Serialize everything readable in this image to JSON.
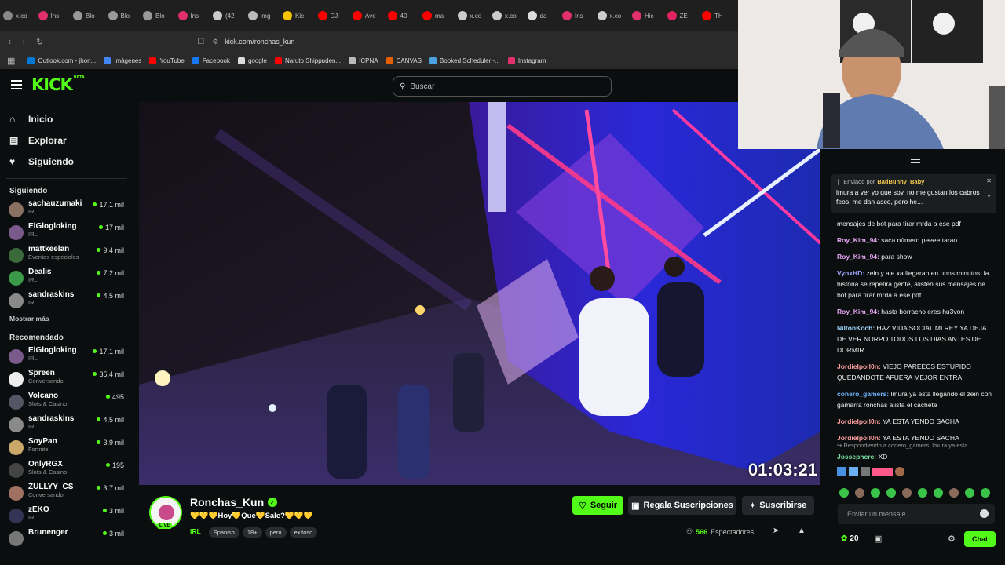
{
  "browser": {
    "tabs": [
      "x.co",
      "Ins",
      "Blo",
      "Blo",
      "Blo",
      "Ins",
      "(42",
      "img",
      "Kic",
      "DJ",
      "Ave",
      "40",
      "ma",
      "x.co",
      "x.co",
      "da",
      "Ins",
      "x.co",
      "Hic",
      "ZE",
      "TH"
    ],
    "tab_colors": [
      "#888",
      "#e1306c",
      "#999",
      "#999",
      "#999",
      "#e1306c",
      "#ccc",
      "#bbb",
      "#f5c400",
      "#ff0000",
      "#ff0000",
      "#ff0000",
      "#ff0000",
      "#ccc",
      "#ccc",
      "#ddd",
      "#e1306c",
      "#ccc",
      "#e1306c",
      "#e0245e",
      "#ff0000"
    ],
    "url": "kick.com/ronchas_kun",
    "bookmarks": [
      {
        "label": "Outlook.com - jhon...",
        "color": "#0078d4"
      },
      {
        "label": "Imágenes",
        "color": "#4285f4"
      },
      {
        "label": "YouTube",
        "color": "#ff0000"
      },
      {
        "label": "Facebook",
        "color": "#1877f2"
      },
      {
        "label": "google",
        "color": "#ddd"
      },
      {
        "label": "Naruto Shippuden...",
        "color": "#ff0000"
      },
      {
        "label": "ICPNA",
        "color": "#bbb"
      },
      {
        "label": "CANVAS",
        "color": "#e66000"
      },
      {
        "label": "Booked Scheduler -...",
        "color": "#4aa3df"
      },
      {
        "label": "Instagram",
        "color": "#e1306c"
      }
    ]
  },
  "kick": {
    "logo": "KICK",
    "logo_badge": "BETA",
    "search_placeholder": "Buscar",
    "brand_color": "#53fc18"
  },
  "sidebar": {
    "nav": [
      {
        "label": "Inicio",
        "icon": "home-icon"
      },
      {
        "label": "Explorar",
        "icon": "browse-icon"
      },
      {
        "label": "Siguiendo",
        "icon": "heart-icon"
      }
    ],
    "following_title": "Siguiendo",
    "following": [
      {
        "name": "sachauzumaki",
        "category": "IRL",
        "viewers": "17,1 mil",
        "color": "#8a7060"
      },
      {
        "name": "ElGlogloking",
        "category": "IRL",
        "viewers": "17 mil",
        "color": "#7a5a8a"
      },
      {
        "name": "mattkeelan",
        "category": "Eventos especiales",
        "viewers": "9,4 mil",
        "color": "#3a6a3a"
      },
      {
        "name": "Dealis",
        "category": "IRL",
        "viewers": "7,2 mil",
        "color": "#3a9a4a"
      },
      {
        "name": "sandraskins",
        "category": "IRL",
        "viewers": "4,5 mil",
        "color": "#8a8a8a"
      }
    ],
    "show_more": "Mostrar más",
    "recommended_title": "Recomendado",
    "recommended": [
      {
        "name": "ElGlogloking",
        "category": "IRL",
        "viewers": "17,1 mil",
        "color": "#7a5a8a"
      },
      {
        "name": "Spreen",
        "category": "Conversando",
        "viewers": "35,4 mil",
        "color": "#eee"
      },
      {
        "name": "Volcano",
        "category": "Slots & Casino",
        "viewers": "495",
        "color": "#556"
      },
      {
        "name": "sandraskins",
        "category": "IRL",
        "viewers": "4,5 mil",
        "color": "#8a8a8a"
      },
      {
        "name": "SoyPan",
        "category": "Fortnite",
        "viewers": "3,9 mil",
        "color": "#c9a86a"
      },
      {
        "name": "OnlyRGX",
        "category": "Slots & Casino",
        "viewers": "195",
        "color": "#444"
      },
      {
        "name": "ZULLYY_CS",
        "category": "Conversando",
        "viewers": "3,7 mil",
        "color": "#a07060"
      },
      {
        "name": "zEKO",
        "category": "IRL",
        "viewers": "3 mil",
        "color": "#335"
      },
      {
        "name": "Brunenger",
        "category": "",
        "viewers": "3 mil",
        "color": "#777"
      }
    ]
  },
  "video": {
    "timer": "01:03:21"
  },
  "stream": {
    "channel": "Ronchas_Kun",
    "live_badge": "LIVE",
    "title": "💛💛💛Hoy💛Que💛Sale?💛💛💛",
    "category": "IRL",
    "tags": [
      "Spanish",
      "18+",
      "perú",
      "exitoso"
    ],
    "follow_label": "Seguir",
    "gift_label": "Regala Suscripciones",
    "subscribe_label": "Suscribirse",
    "viewers_count": "566",
    "viewers_label": "Espectadores"
  },
  "chat": {
    "pinned_by_label": "Enviado por",
    "pinned_by_user": "BadBunny_Baby",
    "pinned_text": "lmura a ver yo que soy, no me gustan los cabros feos, me dan asco, pero he...",
    "messages": [
      {
        "user": "",
        "text": "mensajes de bot para tirar mrda a ese pdf",
        "color": "#ccc"
      },
      {
        "user": "Roy_Kim_94:",
        "text": "saca número peeee tarao",
        "color": "#e5a4f0"
      },
      {
        "user": "Roy_Kim_94:",
        "text": "para show",
        "color": "#e5a4f0"
      },
      {
        "user": "VynxHD:",
        "text": "zein y ale xa llegaran en unos minutos, la historia se repetira gente, alisten sus mensajes de bot para tirar mrda a ese pdf",
        "color": "#9fa8ff"
      },
      {
        "user": "Roy_Kim_94:",
        "text": "hasta borracho eres hu3von",
        "color": "#e5a4f0"
      },
      {
        "user": "NiltonKoch:",
        "text": "HAZ VIDA SOCIAL MI REY YA DEJA DE VER NORPO TODOS LOS DIAS ANTES DE DORMIR",
        "color": "#9fd7ff"
      },
      {
        "user": "Jordielpoll0n:",
        "text": "VIEJO PAREECS ESTUPIDO QUEDANDOTE AFUERA MEJOR ENTRA",
        "color": "#ff9f9f"
      },
      {
        "user": "conero_gamers:",
        "text": "lmura ya esta llegando el zein con gamarra ronchas alista el cachete",
        "color": "#6fb4ff"
      },
      {
        "user": "Jordielpoll0n:",
        "text": "YA ESTA YENDO SACHA",
        "color": "#ff9f9f"
      },
      {
        "user": "Jordielpoll0n:",
        "text": "YA ESTA YENDO SACHA",
        "color": "#ff9f9f"
      }
    ],
    "reply_label": "Respondiendo a conero_gamers: lmura ya esta...",
    "last_user": "Jossephcrc:",
    "last_text": "XD",
    "input_placeholder": "Enviar un mensaje",
    "points": "20",
    "chat_button": "Chat"
  }
}
